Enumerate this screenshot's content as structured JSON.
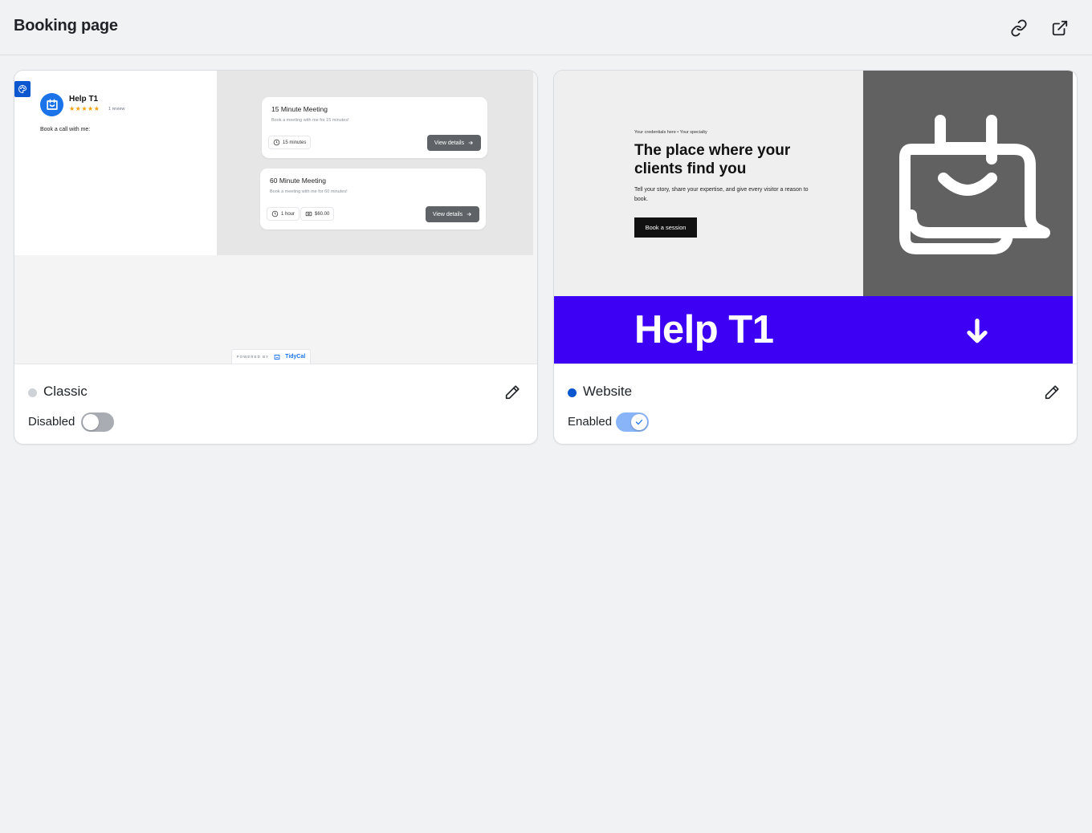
{
  "header": {
    "title": "Booking page",
    "copy_link_icon": "link-icon",
    "open_external_icon": "external-link-icon"
  },
  "colors": {
    "accent": "#0b57d0",
    "toggle_on": "#8ab4f8",
    "toggle_off": "#a9adb3",
    "status_active": "#0b57d0",
    "status_inactive": "#cfd2d6",
    "website_band": "#3d00f5"
  },
  "cards": [
    {
      "name": "Classic",
      "toggle_label": "Disabled",
      "enabled": false,
      "preview": {
        "theme_badge_icon": "palette-icon",
        "profile_name": "Help T1",
        "rating_stars": "★★★★★",
        "rating_value": 5,
        "review_count": "1 review",
        "intro": "Book a call with me:",
        "meetings": [
          {
            "title": "15 Minute Meeting",
            "description": "Book a meeting with me for 15 minutes!",
            "duration": "15 minutes",
            "price": "",
            "button": "View details"
          },
          {
            "title": "60 Minute Meeting",
            "description": "Book a meeting with me for 60 minutes!",
            "duration": "1 hour",
            "price": "$60.00",
            "button": "View details"
          }
        ],
        "powered_by": "POWERED BY",
        "powered_brand": "TidyCal"
      }
    },
    {
      "name": "Website",
      "toggle_label": "Enabled",
      "enabled": true,
      "preview": {
        "credentials": "Your credentials here • Your specialty",
        "headline": "The place where your clients find you",
        "subtext": "Tell your story, share your expertise, and give every visitor a reason to book.",
        "cta": "Book a session",
        "brand": "Help T1",
        "hero_icon": "calendar-smile-icon",
        "scroll_icon": "arrow-down-icon"
      }
    }
  ]
}
